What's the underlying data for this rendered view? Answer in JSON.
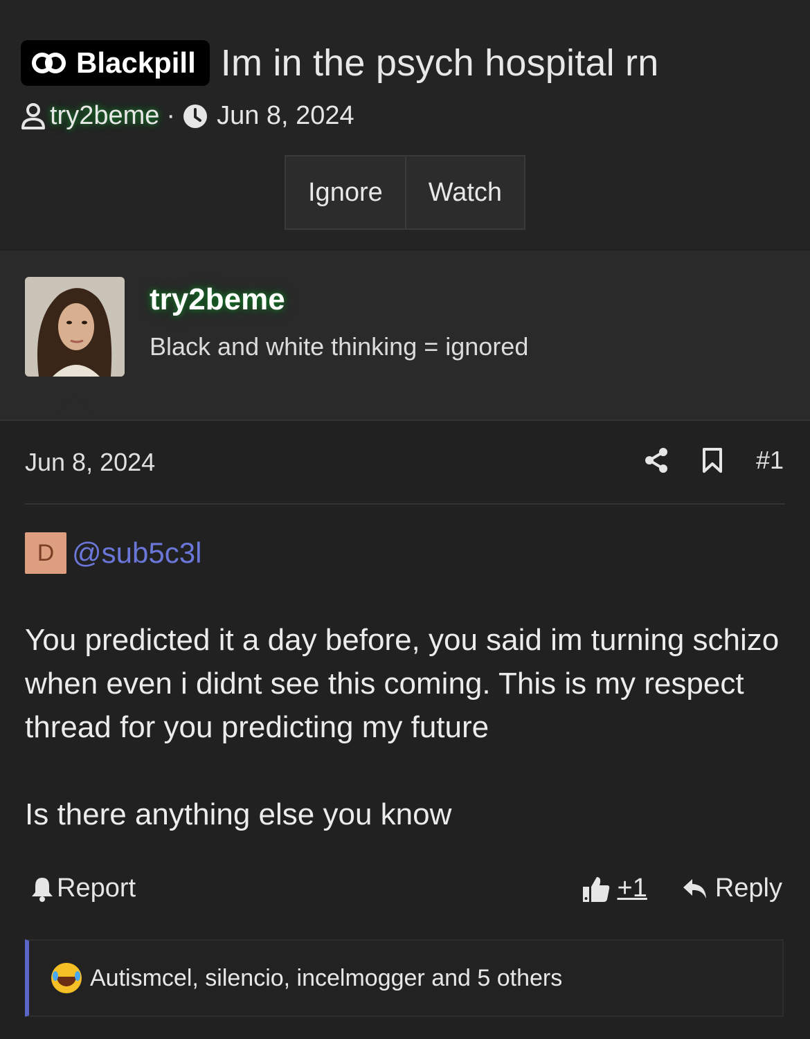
{
  "thread": {
    "prefix": "Blackpill",
    "title": "Im in the psych hospital rn",
    "author": "try2beme",
    "date": "Jun 8, 2024",
    "separator": "·"
  },
  "buttons": {
    "ignore": "Ignore",
    "watch": "Watch"
  },
  "user": {
    "name": "try2beme",
    "title": "Black and white thinking = ignored"
  },
  "post": {
    "date": "Jun 8, 2024",
    "number": "#1",
    "mention_initial": "D",
    "mention": "@sub5c3l",
    "body_1": "You predicted it a day before, you said im turning schizo when even i didnt see this coming. This is my respect thread for you predicting my future",
    "body_2": "Is there anything else you know",
    "report": "Report",
    "plus_one": "+1",
    "reply": "Reply",
    "reactions_text": "Autismcel, silencio, incelmogger and 5 others"
  },
  "colors": {
    "background": "#212121",
    "mention_link": "#6a77d8",
    "reactions_accent": "#5a67c8",
    "username_glow": "#167a2a"
  }
}
